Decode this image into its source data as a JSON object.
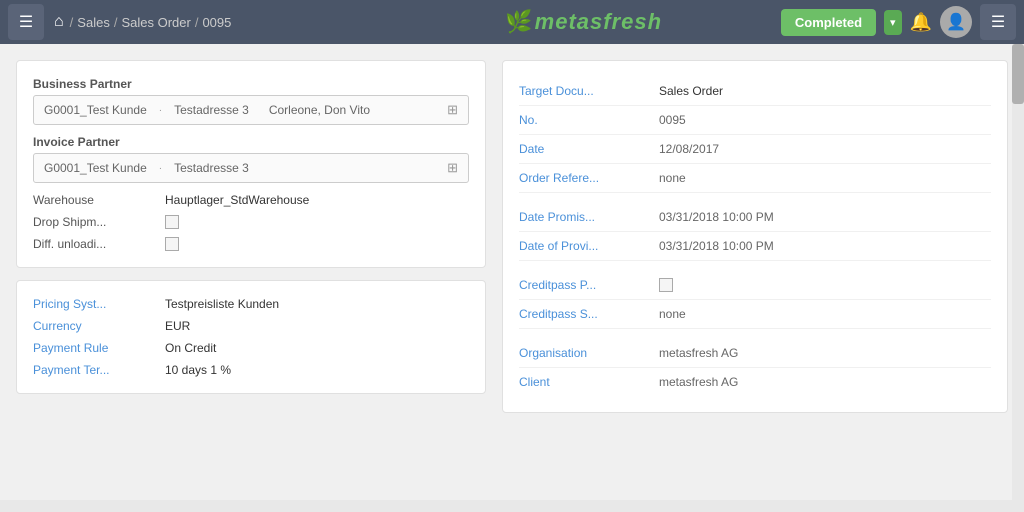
{
  "header": {
    "hamburger_label": "☰",
    "home_icon": "⌂",
    "breadcrumb": {
      "sales": "Sales",
      "sep1": "/",
      "sales_order": "Sales Order",
      "sep2": "/",
      "order_no": "0095"
    },
    "logo_leaf": "🌿",
    "logo_text": "metasfresh",
    "status_label": "Completed",
    "dropdown_arrow": "▾",
    "bell_icon": "🔔",
    "avatar_icon": "👤",
    "menu_icon": "☰"
  },
  "left_card1": {
    "section1_label": "Business Partner",
    "bp_part1": "G0001_Test Kunde",
    "bp_sep": "·",
    "bp_part2": "Testadresse 3",
    "bp_part3": "Corleone, Don Vito",
    "bp_expand": "⊞",
    "section2_label": "Invoice Partner",
    "ip_part1": "G0001_Test Kunde",
    "ip_sep": "·",
    "ip_part2": "Testadresse 3",
    "ip_expand": "⊞",
    "warehouse_label": "Warehouse",
    "warehouse_value": "Hauptlager_StdWarehouse",
    "drop_label": "Drop Shipm...",
    "diff_label": "Diff. unloadi..."
  },
  "left_card2": {
    "pricing_label": "Pricing Syst...",
    "pricing_value": "Testpreisliste Kunden",
    "currency_label": "Currency",
    "currency_value": "EUR",
    "payment_rule_label": "Payment Rule",
    "payment_rule_value": "On Credit",
    "payment_term_label": "Payment Ter...",
    "payment_term_value": "10 days 1 %"
  },
  "right_panel": {
    "fields": [
      {
        "label": "Target Docu...",
        "value": "Sales Order"
      },
      {
        "label": "No.",
        "value": "0095"
      },
      {
        "label": "Date",
        "value": "12/08/2017"
      },
      {
        "label": "Order Refere...",
        "value": "none"
      },
      {
        "label": "",
        "value": ""
      },
      {
        "label": "Date Promis...",
        "value": "03/31/2018 10:00 PM"
      },
      {
        "label": "Date of Provi...",
        "value": "03/31/2018 10:00 PM"
      },
      {
        "label": "",
        "value": ""
      },
      {
        "label": "Creditpass P...",
        "value": "checkbox"
      },
      {
        "label": "Creditpass S...",
        "value": "none"
      },
      {
        "label": "",
        "value": ""
      },
      {
        "label": "Organisation",
        "value": "metasfresh AG"
      },
      {
        "label": "Client",
        "value": "metasfresh AG"
      }
    ]
  },
  "colors": {
    "header_bg": "#4a5568",
    "status_green": "#6dbf67",
    "link_blue": "#4a90d9"
  }
}
